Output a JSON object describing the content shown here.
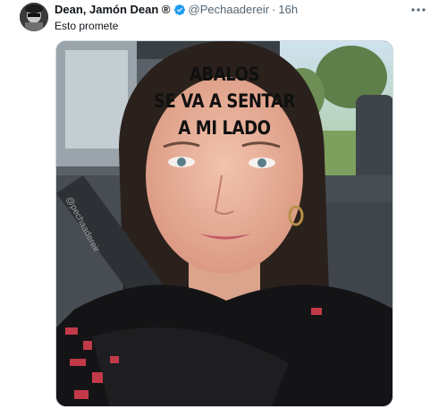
{
  "tweet": {
    "author": {
      "display_name": "Dean, Jamón Dean ®",
      "handle": "@Pechaadereir",
      "verified": true
    },
    "separator": "·",
    "time": "16h",
    "text": "Esto promete",
    "media": {
      "caption_lines": [
        "ABALOS",
        "SE VA A SENTAR",
        "A MI LADO"
      ],
      "watermark": "@pechaadereir"
    }
  },
  "colors": {
    "verified": "#1d9bf0",
    "secondary_text": "#536471",
    "primary_text": "#0f1419"
  },
  "icons": {
    "verified": "verified-badge-icon",
    "more": "more-dots-icon"
  }
}
